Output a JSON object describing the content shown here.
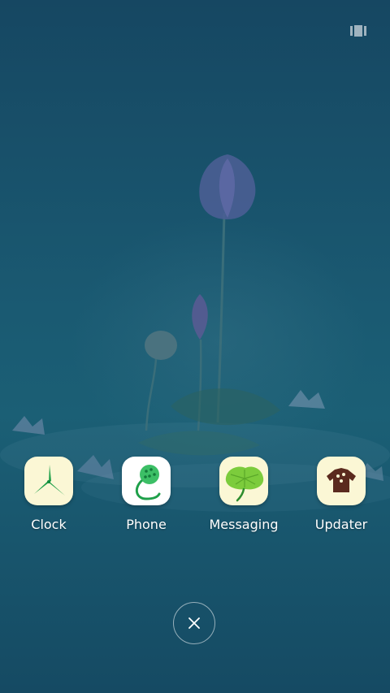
{
  "wallpaper": {
    "name": "lotus-pond-wallpaper"
  },
  "top_bar": {
    "overview_icon": "recents-overview-icon"
  },
  "apps": [
    {
      "label": "Clock",
      "icon": "clock-pinwheel-icon",
      "icon_bg": "#fbf7d5"
    },
    {
      "label": "Phone",
      "icon": "phone-lotus-pod-icon",
      "icon_bg": "#ffffff"
    },
    {
      "label": "Messaging",
      "icon": "messaging-lotus-leaf-icon",
      "icon_bg": "#fbf7d5"
    },
    {
      "label": "Updater",
      "icon": "updater-shirt-icon",
      "icon_bg": "#fbf7d5"
    }
  ],
  "close_button": {
    "icon": "close-icon"
  },
  "colors": {
    "background": "#164a63",
    "label_text": "#ffffff",
    "accent_green": "#1fa04a"
  }
}
